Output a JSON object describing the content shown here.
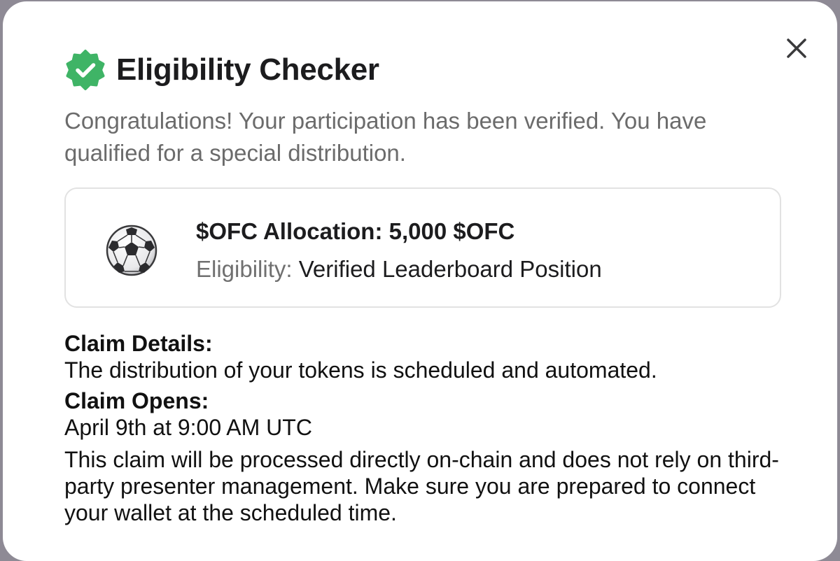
{
  "dialog": {
    "title": "Eligibility Checker",
    "subtitle": "Congratulations! Your participation has been verified. You have qualified for a special distribution.",
    "icons": {
      "badge": "verified-check-badge-icon",
      "close": "close-icon",
      "ball": "soccer-ball-icon"
    },
    "colors": {
      "badge_green": "#3fb466",
      "text_dark": "#1c1c1e",
      "text_muted": "#6b6b6b"
    }
  },
  "allocation": {
    "title": "$OFC Allocation: 5,000 $OFC",
    "eligibility_label": "Eligibility:",
    "eligibility_value": "Verified Leaderboard Position"
  },
  "claim": {
    "details_heading": "Claim Details:",
    "details_text": "The distribution of your tokens is scheduled and automated.",
    "opens_heading": "Claim Opens:",
    "opens_text": "April 9th at 9:00 AM UTC",
    "note": "This claim will be processed directly on-chain and does not rely on third-party presenter management. Make sure you are prepared to connect your wallet at the scheduled time."
  }
}
